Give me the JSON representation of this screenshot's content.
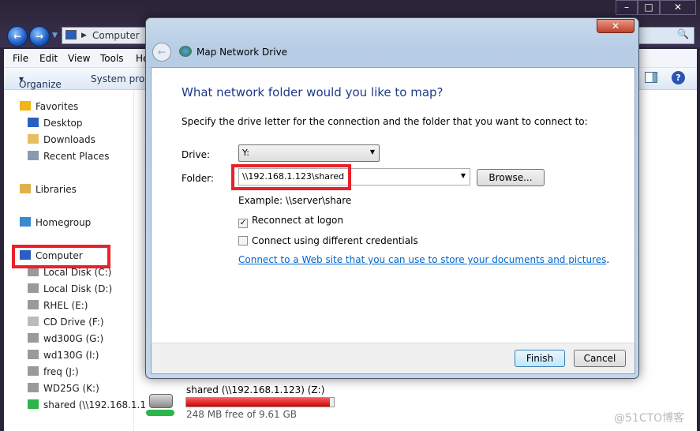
{
  "explorer": {
    "address": "Computer",
    "menu": [
      "File",
      "Edit",
      "View",
      "Tools",
      "He"
    ],
    "toolbar": {
      "organize": "Organize",
      "system_properties": "System prope"
    },
    "sidebar": [
      {
        "label": "Favorites",
        "icon": "star-icon"
      },
      {
        "label": "Desktop",
        "icon": "desktop-icon"
      },
      {
        "label": "Downloads",
        "icon": "folder-icon"
      },
      {
        "label": "Recent Places",
        "icon": "recent-icon"
      },
      {
        "label": "Libraries",
        "icon": "library-icon"
      },
      {
        "label": "Homegroup",
        "icon": "homegroup-icon"
      },
      {
        "label": "Computer",
        "icon": "computer-icon"
      },
      {
        "label": "Local Disk (C:)",
        "icon": "drive-icon"
      },
      {
        "label": "Local Disk (D:)",
        "icon": "drive-icon"
      },
      {
        "label": "RHEL (E:)",
        "icon": "drive-icon"
      },
      {
        "label": "CD Drive (F:)",
        "icon": "cd-icon"
      },
      {
        "label": "wd300G (G:)",
        "icon": "drive-icon"
      },
      {
        "label": "wd130G (I:)",
        "icon": "drive-icon"
      },
      {
        "label": "freq (J:)",
        "icon": "drive-icon"
      },
      {
        "label": "WD25G (K:)",
        "icon": "drive-icon"
      },
      {
        "label": "shared (\\\\192.168.1.1",
        "icon": "network-drive-icon"
      }
    ],
    "drive": {
      "name": "shared (\\\\192.168.1.123) (Z:)",
      "free": "248 MB free of 9.61 GB",
      "used_percent": 97.5,
      "bar_color": "#d40000"
    }
  },
  "dialog": {
    "title": "Map Network Drive",
    "heading": "What network folder would you like to map?",
    "instruction": "Specify the drive letter for the connection and the folder that you want to connect to:",
    "drive_label": "Drive:",
    "drive_value": "Y:",
    "folder_label": "Folder:",
    "folder_value": "\\\\192.168.1.123\\shared",
    "browse": "Browse...",
    "example": "Example: \\\\server\\share",
    "reconnect": "Reconnect at logon",
    "reconnect_checked": true,
    "different_credentials": "Connect using different credentials",
    "different_credentials_checked": false,
    "link": "Connect to a Web site that you can use to store your documents and pictures",
    "link_suffix": ".",
    "finish": "Finish",
    "cancel": "Cancel"
  },
  "watermark": "@51CTO博客",
  "colors": {
    "highlight": "#e8212b",
    "heading": "#1e3a8a",
    "link": "#0066cc"
  }
}
